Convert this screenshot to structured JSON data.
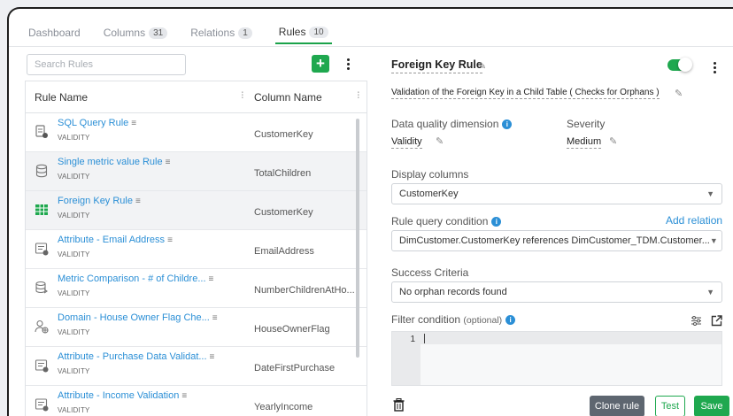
{
  "tabs": [
    {
      "label": "Dashboard",
      "count": ""
    },
    {
      "label": "Columns",
      "count": "31"
    },
    {
      "label": "Relations",
      "count": "1"
    },
    {
      "label": "Rules",
      "count": "10"
    }
  ],
  "left": {
    "search_placeholder": "Search Rules",
    "col_rule_name": "Rule Name",
    "col_column_name": "Column Name",
    "rows": [
      {
        "name": "SQL Query Rule",
        "category": "VALIDITY",
        "column": "CustomerKey",
        "icon": "sql-rule-icon"
      },
      {
        "name": "Single metric value Rule",
        "category": "VALIDITY",
        "column": "TotalChildren",
        "icon": "metric-rule-icon"
      },
      {
        "name": "Foreign Key Rule",
        "category": "VALIDITY",
        "column": "CustomerKey",
        "icon": "foreign-key-rule-icon"
      },
      {
        "name": "Attribute - Email Address",
        "category": "VALIDITY",
        "column": "EmailAddress",
        "icon": "attribute-rule-icon"
      },
      {
        "name": "Metric Comparison - # of Childre...",
        "category": "VALIDITY",
        "column": "NumberChildrenAtHo...",
        "icon": "comparison-rule-icon"
      },
      {
        "name": "Domain - House Owner Flag Che...",
        "category": "VALIDITY",
        "column": "HouseOwnerFlag",
        "icon": "domain-rule-icon"
      },
      {
        "name": "Attribute - Purchase Data Validat...",
        "category": "VALIDITY",
        "column": "DateFirstPurchase",
        "icon": "attribute-rule-icon"
      },
      {
        "name": "Attribute - Income Validation",
        "category": "VALIDITY",
        "column": "YearlyIncome",
        "icon": "attribute-rule-icon"
      }
    ]
  },
  "detail": {
    "title": "Foreign Key Rule",
    "description": "Validation of the Foreign Key in a Child Table ( Checks for Orphans )",
    "dq_label": "Data quality dimension",
    "dq_value": "Validity",
    "severity_label": "Severity",
    "severity_value": "Medium",
    "display_columns_label": "Display columns",
    "display_columns_value": "CustomerKey",
    "query_label": "Rule query condition",
    "add_relation": "Add relation",
    "query_value": "DimCustomer.CustomerKey references DimCustomer_TDM.Customer...",
    "success_label": "Success Criteria",
    "success_value": "No orphan records found",
    "filter_label": "Filter condition",
    "filter_optional": "(optional)",
    "editor_line": "1",
    "enabled": true
  },
  "buttons": {
    "clone": "Clone rule",
    "test": "Test",
    "save": "Save"
  },
  "colors": {
    "accent_green": "#1fa84f",
    "link_blue": "#2b8fd6"
  }
}
